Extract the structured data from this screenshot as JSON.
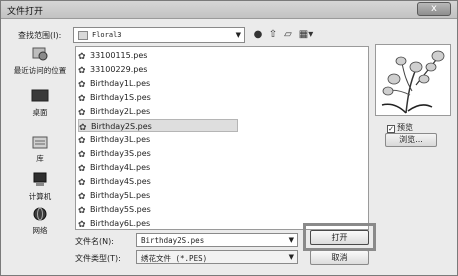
{
  "window": {
    "title": "文件打开",
    "close_label": "x"
  },
  "lookin": {
    "label": "查找范围(I):",
    "value": "Floral3"
  },
  "toolbar": {
    "back_icon": "back-icon",
    "up_icon": "up-folder-icon",
    "new_folder_icon": "new-folder-icon",
    "view_icon": "view-menu-icon"
  },
  "places": [
    {
      "label": "最近访问的位置",
      "icon": "recent-places-icon"
    },
    {
      "label": "桌面",
      "icon": "desktop-icon"
    },
    {
      "label": "库",
      "icon": "libraries-icon"
    },
    {
      "label": "计算机",
      "icon": "computer-icon"
    },
    {
      "label": "网络",
      "icon": "network-icon"
    }
  ],
  "files": [
    "33100115.pes",
    "33100229.pes",
    "Birthday1L.pes",
    "Birthday1S.pes",
    "Birthday2L.pes",
    "Birthday2S.pes",
    "Birthday3L.pes",
    "Birthday3S.pes",
    "Birthday4L.pes",
    "Birthday4S.pes",
    "Birthday5L.pes",
    "Birthday5S.pes",
    "Birthday6L.pes"
  ],
  "selected_file": "Birthday2S.pes",
  "preview": {
    "checkbox_label": "预览",
    "checked": true,
    "browse_label": "浏览..."
  },
  "filename": {
    "label": "文件名(N):",
    "value": "Birthday2S.pes"
  },
  "filetype": {
    "label": "文件类型(T):",
    "value": "绣花文件 (*.PES)"
  },
  "buttons": {
    "open": "打开",
    "cancel": "取消"
  }
}
